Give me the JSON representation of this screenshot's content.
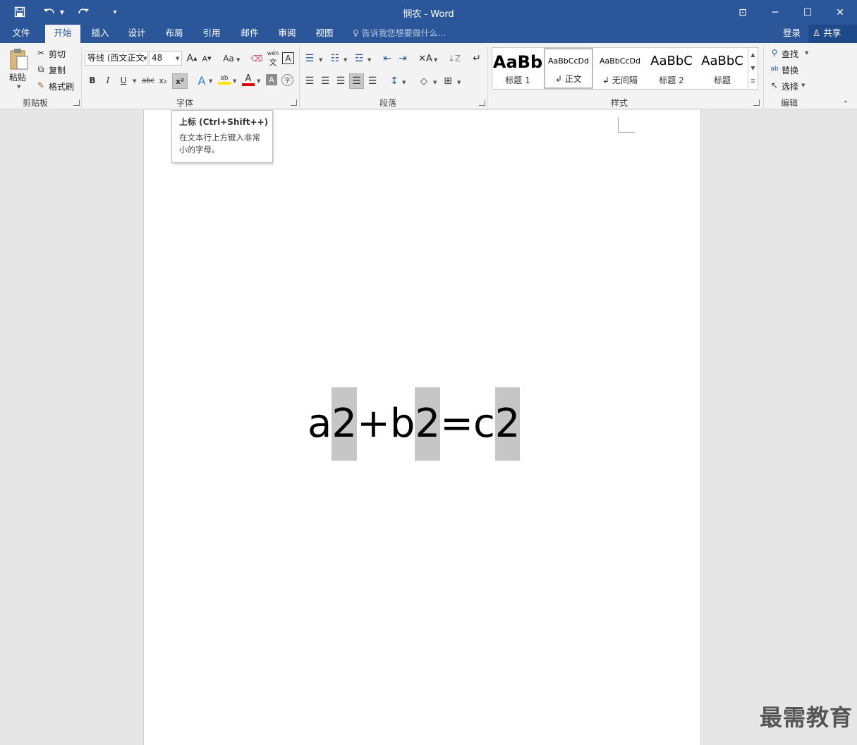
{
  "window": {
    "title": "悯农 - Word",
    "minimize": "─",
    "maximize": "☐",
    "close": "✕",
    "ribbon_display": "⊡"
  },
  "quick_access": {
    "save_icon": "save-icon",
    "undo_icon": "undo-icon",
    "redo_icon": "redo-icon",
    "customize_icon": "customize-icon"
  },
  "tabs": [
    "文件",
    "开始",
    "插入",
    "设计",
    "布局",
    "引用",
    "邮件",
    "审阅",
    "视图"
  ],
  "active_tab": "开始",
  "tell_me": "告诉我您想要做什么...",
  "sign_in": "登录",
  "share": "共享",
  "clipboard": {
    "paste": "粘贴",
    "cut": "剪切",
    "copy": "复制",
    "format_painter": "格式刷",
    "group_label": "剪贴板"
  },
  "font": {
    "font_name": "等线 (西文正文",
    "font_size": "48",
    "bold": "B",
    "italic": "I",
    "underline": "U",
    "strikethrough": "abc",
    "subscript": "x₂",
    "superscript": "x²",
    "grow": "A",
    "shrink": "A",
    "change_case": "Aa",
    "phonetic": "wén",
    "group_label": "字体"
  },
  "paragraph": {
    "group_label": "段落"
  },
  "styles": {
    "items": [
      {
        "preview": "AaBb",
        "name": "标题 1"
      },
      {
        "preview": "AaBbCcDd",
        "name": "正文"
      },
      {
        "preview": "AaBbCcDd",
        "name": "无间隔"
      },
      {
        "preview": "AaBbC",
        "name": "标题 2"
      },
      {
        "preview": "AaBbC",
        "name": "标题"
      }
    ],
    "group_label": "样式"
  },
  "editing": {
    "find": "查找",
    "replace": "替换",
    "select": "选择",
    "group_label": "编辑"
  },
  "tooltip": {
    "title": "上标 (Ctrl+Shift++)",
    "body": "在文本行上方键入非常小的字母。"
  },
  "document": {
    "equation": [
      {
        "text": "a",
        "selected": false
      },
      {
        "text": "2",
        "selected": true
      },
      {
        "text": "+b",
        "selected": false
      },
      {
        "text": "2",
        "selected": true
      },
      {
        "text": "=c",
        "selected": false
      },
      {
        "text": "2",
        "selected": true
      }
    ]
  },
  "watermark": "最需教育",
  "colors": {
    "title_bar": "#2b579a",
    "ribbon": "#f3f3f3",
    "selection": "#c6c6c6",
    "highlight_circle": "#e02020"
  }
}
